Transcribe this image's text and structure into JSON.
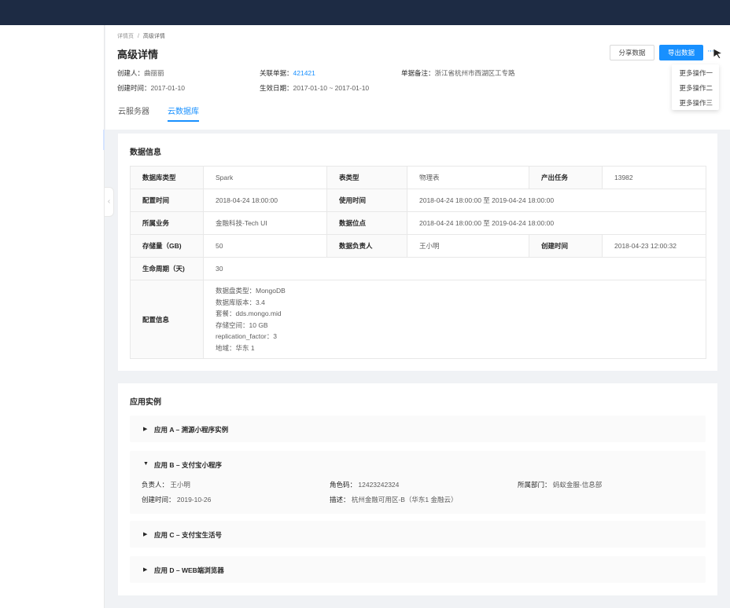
{
  "breadcrumb": {
    "first": "详情页",
    "sep": "/",
    "last": "高级详情"
  },
  "page_title": "高级详情",
  "meta": {
    "creator_label": "创建人：",
    "creator": "曲丽丽",
    "order_label": "关联单据：",
    "order": "421421",
    "note_label": "单据备注：",
    "note": "浙江省杭州市西湖区工专路",
    "created_label": "创建时间：",
    "created": "2017-01-10",
    "effective_label": "生效日期：",
    "effective": "2017-01-10 ~ 2017-01-10"
  },
  "actions": {
    "share": "分享数据",
    "export": "导出数据",
    "more": "···",
    "menu": [
      "更多操作一",
      "更多操作二",
      "更多操作三"
    ]
  },
  "tabs": [
    {
      "label": "云服务器",
      "active": false
    },
    {
      "label": "云数据库",
      "active": true
    }
  ],
  "data_info": {
    "title": "数据信息",
    "rows": [
      [
        "数据库类型",
        "Spark",
        "表类型",
        "物理表",
        "产出任务",
        "13982"
      ],
      [
        "配置时间",
        "2018-04-24 18:00:00",
        "使用时间",
        "2018-04-24 18:00:00 至 2019-04-24 18:00:00"
      ],
      [
        "所属业务",
        "金融科技-Tech UI",
        "数据位点",
        "2018-04-24 18:00:00 至 2019-04-24 18:00:00"
      ],
      [
        "存储量（GB)",
        "50",
        "数据负责人",
        "王小明",
        "创建时间",
        "2018-04-23 12:00:32"
      ],
      [
        "生命周期（天)",
        "30"
      ]
    ],
    "config_label": "配置信息",
    "config_lines": [
      "数据盘类型：MongoDB",
      "数据库版本：3.4",
      "套餐：dds.mongo.mid",
      "存储空间：10 GB",
      "replication_factor：3",
      "地域：华东 1"
    ]
  },
  "apps": {
    "title": "应用实例",
    "items": [
      {
        "title": "应用 A – 溯源小程序实例",
        "expanded": false
      },
      {
        "title": "应用 B – 支付宝小程序",
        "expanded": true,
        "owner_label": "负责人：",
        "owner": "王小明",
        "role_label": "角色码：",
        "role": "12423242324",
        "dept_label": "所属部门：",
        "dept": "蚂蚁金服-信息部",
        "created_label": "创建时间：",
        "created": "2019-10-26",
        "desc_label": "描述：",
        "desc": "杭州金融可用区-B（华东1 金融云）"
      },
      {
        "title": "应用 C – 支付宝生活号",
        "expanded": false
      },
      {
        "title": "应用 D – WEB端浏览器",
        "expanded": false
      }
    ]
  },
  "colors": {
    "topbar": "#1d2b44",
    "primary": "#1890ff"
  },
  "icons": {
    "collapse": "chevron-left-icon",
    "expand_closed": "caret-right-icon",
    "expand_open": "caret-down-icon",
    "cursor": "mouse-pointer-icon"
  }
}
